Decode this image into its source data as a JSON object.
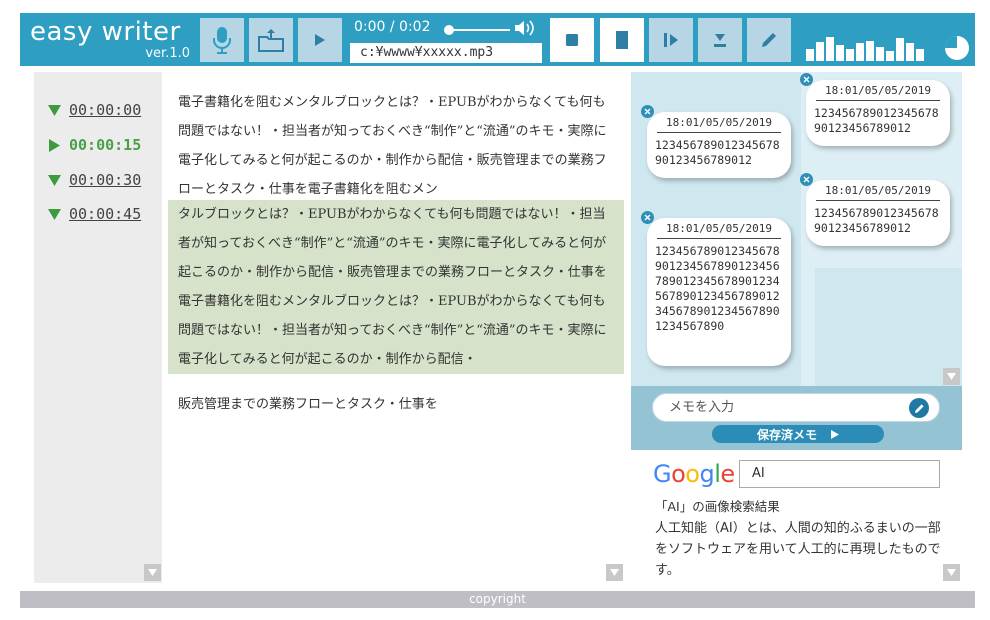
{
  "app": {
    "title": "easy writer",
    "version": "ver.1.0",
    "accent": "#2e9ec2"
  },
  "toolbar": {
    "mic_icon": "microphone-icon",
    "upload_icon": "folder-upload-icon",
    "play_icon": "play-icon",
    "stop_icon": "stop-icon",
    "pause_icon": "pause-icon",
    "step_icon": "step-forward-icon",
    "download_icon": "download-icon",
    "edit_icon": "pencil-icon"
  },
  "player": {
    "time_display": "0:00 / 0:02",
    "progress": 0.0,
    "file_path": "c:¥wwww¥xxxxx.mp3"
  },
  "timestamps": [
    {
      "label": "00:00:00",
      "active": false
    },
    {
      "label": "00:00:15",
      "active": true
    },
    {
      "label": "00:00:30",
      "active": false
    },
    {
      "label": "00:00:45",
      "active": false
    }
  ],
  "transcript": {
    "para1": "電子書籍化を阻むメンタルブロックとは？・EPUBがわからなくても何も問題ではない！・担当者が知っておくべき“制作”と“流通”のキモ・実際に電子化してみると何が起こるのか・制作から配信・販売管理までの業務フローとタスク・仕事を電子書籍化を阻むメン",
    "para2": "タルブロックとは？・EPUBがわからなくても何も問題ではない！・担当者が知っておくべき“制作”と“流通”のキモ・実際に電子化してみると何が起こるのか・制作から配信・販売管理までの業務フローとタスク・仕事を電子書籍化を阻むメンタルブロックとは？・EPUBがわからなくても何も問題ではない！・担当者が知っておくべき“制作”と“流通”のキモ・実際に電子化してみると何が起こるのか・制作から配信・",
    "para3": "販売管理までの業務フローとタスク・仕事を"
  },
  "memos": [
    {
      "date": "18:01/05/05/2019",
      "text": "12345678901234567890123456789012"
    },
    {
      "date": "18:01/05/05/2019",
      "text": "12345678901234567890123456789012"
    },
    {
      "date": "18:01/05/05/2019",
      "text": "12345678901234567890123456789012"
    },
    {
      "date": "18:01/05/05/2019",
      "text": "1234567890123456789012345678901234567890123456789012345678901234567890123456789012345678901234567890"
    }
  ],
  "memo_input": {
    "placeholder": "メモを入力"
  },
  "saved_memo_button": "保存済メモ",
  "search": {
    "logo": [
      "G",
      "o",
      "o",
      "g",
      "l",
      "e"
    ],
    "query": "AI",
    "result_title": "「AI」の画像検索結果",
    "result_body": "人工知能（AI）とは、人間の知的ふるまいの一部をソフトウェアを用いて人工的に再現したものです。"
  },
  "footer": {
    "text": "copyright"
  }
}
